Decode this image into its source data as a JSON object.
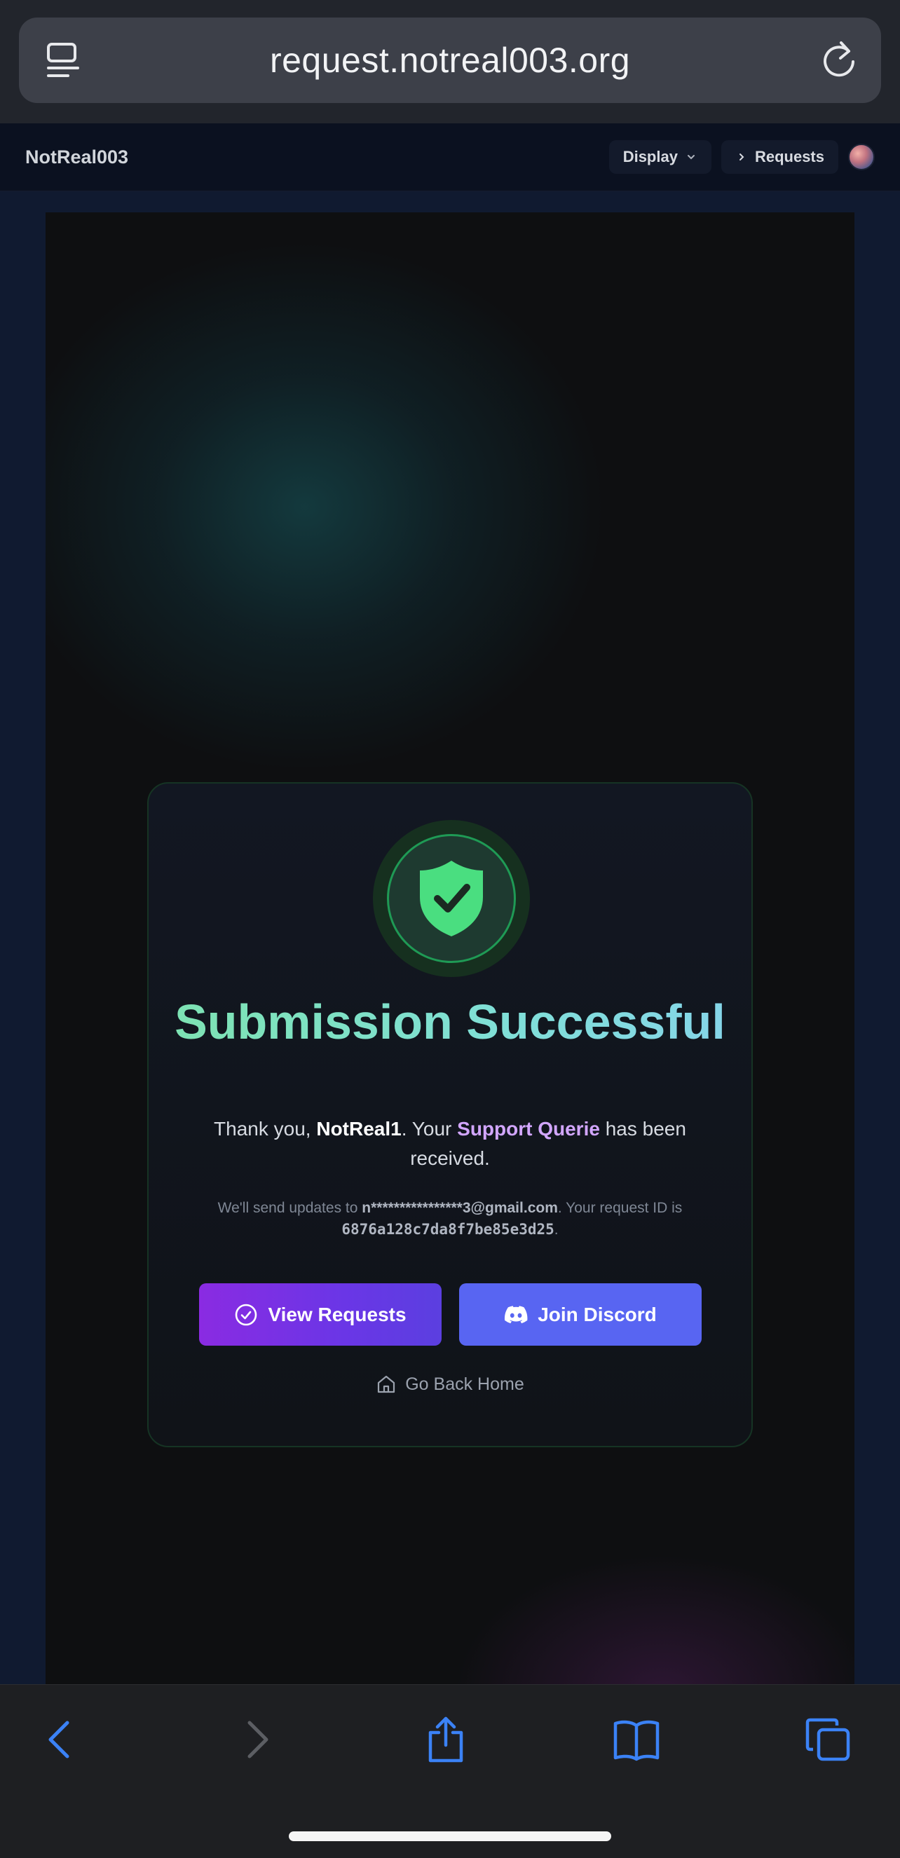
{
  "browser": {
    "url": "request.notreal003.org",
    "tabs_icon": "tab-overview-icon",
    "reload_icon": "reload-icon"
  },
  "nav": {
    "brand": "NotReal003",
    "display_label": "Display",
    "requests_label": "Requests"
  },
  "card": {
    "title": "Submission Successful",
    "thanks_prefix": "Thank you, ",
    "user_name": "NotReal1",
    "thanks_mid": ". Your ",
    "topic": "Support Querie",
    "thanks_suffix": " has been received.",
    "updates_prefix": "We'll send updates to ",
    "email": "n****************3@gmail.com",
    "updates_mid": ". Your request ID is ",
    "request_id": "6876a128c7da8f7be85e3d25",
    "updates_suffix": ".",
    "view_requests_label": "View Requests",
    "join_discord_label": "Join Discord",
    "go_home_label": "Go Back Home"
  },
  "colors": {
    "accent_green": "#4ade80",
    "title_gradient": "#7de3b0",
    "topic_purple": "#d2a6ff",
    "requests_button": "#7c3aed",
    "discord_button": "#5865f2",
    "safari_blue": "#3b82f6"
  },
  "toolbar": {
    "icons": [
      "back-icon",
      "forward-icon",
      "share-icon",
      "bookmarks-icon",
      "tabs-icon"
    ]
  }
}
